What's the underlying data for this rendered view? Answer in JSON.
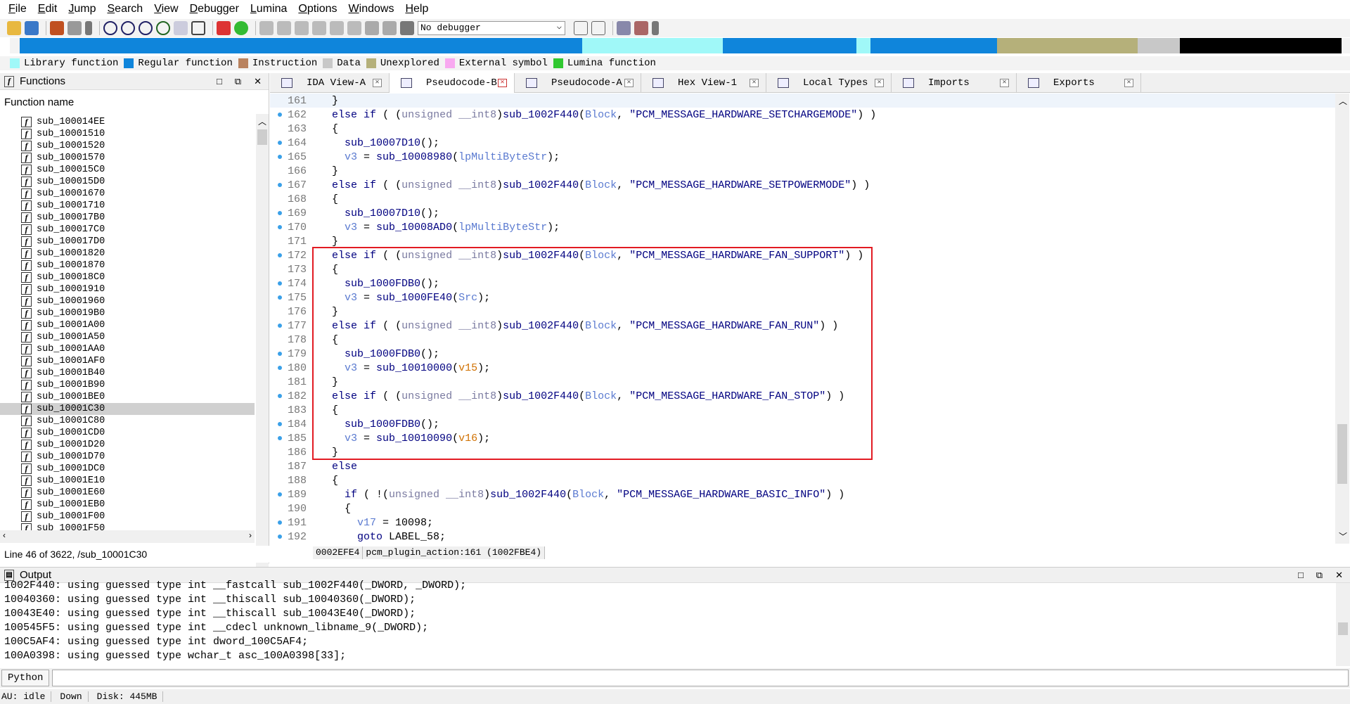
{
  "menu": [
    "File",
    "Edit",
    "Jump",
    "Search",
    "View",
    "Debugger",
    "Lumina",
    "Options",
    "Windows",
    "Help"
  ],
  "toolbar": {
    "debugger_select": "No debugger"
  },
  "legend": [
    {
      "label": "Library function",
      "color": "#a0f8f8"
    },
    {
      "label": "Regular function",
      "color": "#0f85db"
    },
    {
      "label": "Instruction",
      "color": "#b9825e"
    },
    {
      "label": "Data",
      "color": "#c8c8c8"
    },
    {
      "label": "Unexplored",
      "color": "#b5b07a"
    },
    {
      "label": "External symbol",
      "color": "#f8a8f0"
    },
    {
      "label": "Lumina function",
      "color": "#30c830"
    }
  ],
  "functions_panel": {
    "title": "Functions",
    "column_header": "Function name",
    "items": [
      "sub_100014EE",
      "sub_10001510",
      "sub_10001520",
      "sub_10001570",
      "sub_100015C0",
      "sub_100015D0",
      "sub_10001670",
      "sub_10001710",
      "sub_100017B0",
      "sub_100017C0",
      "sub_100017D0",
      "sub_10001820",
      "sub_10001870",
      "sub_100018C0",
      "sub_10001910",
      "sub_10001960",
      "sub_100019B0",
      "sub_10001A00",
      "sub_10001A50",
      "sub_10001AA0",
      "sub_10001AF0",
      "sub_10001B40",
      "sub_10001B90",
      "sub_10001BE0",
      "sub_10001C30",
      "sub_10001C80",
      "sub_10001CD0",
      "sub_10001D20",
      "sub_10001D70",
      "sub_10001DC0",
      "sub_10001E10",
      "sub_10001E60",
      "sub_10001EB0",
      "sub_10001F00",
      "sub_10001F50"
    ],
    "selected_index": 24,
    "status": "Line 46 of 3622, /sub_10001C30"
  },
  "tabs": [
    {
      "label": "IDA View-A",
      "active": false
    },
    {
      "label": "Pseudocode-B",
      "active": true
    },
    {
      "label": "Pseudocode-A",
      "active": false
    },
    {
      "label": "Hex View-1",
      "active": false
    },
    {
      "label": "Local Types",
      "active": false
    },
    {
      "label": "Imports",
      "active": false
    },
    {
      "label": "Exports",
      "active": false
    }
  ],
  "code_lines": [
    {
      "n": "161",
      "dot": false,
      "t": "  }"
    },
    {
      "n": "162",
      "dot": true,
      "t": "  else if ( (unsigned __int8)sub_1002F440(Block, \"PCM_MESSAGE_HARDWARE_SETCHARGEMODE\") )"
    },
    {
      "n": "163",
      "dot": false,
      "t": "  {"
    },
    {
      "n": "164",
      "dot": true,
      "t": "    sub_10007D10();"
    },
    {
      "n": "165",
      "dot": true,
      "t": "    v3 = sub_10008980(lpMultiByteStr);"
    },
    {
      "n": "166",
      "dot": false,
      "t": "  }"
    },
    {
      "n": "167",
      "dot": true,
      "t": "  else if ( (unsigned __int8)sub_1002F440(Block, \"PCM_MESSAGE_HARDWARE_SETPOWERMODE\") )"
    },
    {
      "n": "168",
      "dot": false,
      "t": "  {"
    },
    {
      "n": "169",
      "dot": true,
      "t": "    sub_10007D10();"
    },
    {
      "n": "170",
      "dot": true,
      "t": "    v3 = sub_10008AD0(lpMultiByteStr);"
    },
    {
      "n": "171",
      "dot": false,
      "t": "  }"
    },
    {
      "n": "172",
      "dot": true,
      "t": "  else if ( (unsigned __int8)sub_1002F440(Block, \"PCM_MESSAGE_HARDWARE_FAN_SUPPORT\") )"
    },
    {
      "n": "173",
      "dot": false,
      "t": "  {"
    },
    {
      "n": "174",
      "dot": true,
      "t": "    sub_1000FDB0();"
    },
    {
      "n": "175",
      "dot": true,
      "t": "    v3 = sub_1000FE40(Src);"
    },
    {
      "n": "176",
      "dot": false,
      "t": "  }"
    },
    {
      "n": "177",
      "dot": true,
      "t": "  else if ( (unsigned __int8)sub_1002F440(Block, \"PCM_MESSAGE_HARDWARE_FAN_RUN\") )"
    },
    {
      "n": "178",
      "dot": false,
      "t": "  {"
    },
    {
      "n": "179",
      "dot": true,
      "t": "    sub_1000FDB0();"
    },
    {
      "n": "180",
      "dot": true,
      "t": "    v3 = sub_10010000(v15);"
    },
    {
      "n": "181",
      "dot": false,
      "t": "  }"
    },
    {
      "n": "182",
      "dot": true,
      "t": "  else if ( (unsigned __int8)sub_1002F440(Block, \"PCM_MESSAGE_HARDWARE_FAN_STOP\") )"
    },
    {
      "n": "183",
      "dot": false,
      "t": "  {"
    },
    {
      "n": "184",
      "dot": true,
      "t": "    sub_1000FDB0();"
    },
    {
      "n": "185",
      "dot": true,
      "t": "    v3 = sub_10010090(v16);"
    },
    {
      "n": "186",
      "dot": false,
      "t": "  }"
    },
    {
      "n": "187",
      "dot": false,
      "t": "  else"
    },
    {
      "n": "188",
      "dot": false,
      "t": "  {"
    },
    {
      "n": "189",
      "dot": true,
      "t": "    if ( !(unsigned __int8)sub_1002F440(Block, \"PCM_MESSAGE_HARDWARE_BASIC_INFO\") )"
    },
    {
      "n": "190",
      "dot": false,
      "t": "    {"
    },
    {
      "n": "191",
      "dot": true,
      "t": "      v17 = 10098;"
    },
    {
      "n": "192",
      "dot": true,
      "t": "      goto LABEL_58;"
    }
  ],
  "code_status": {
    "offset": "0002EFE4",
    "location": "pcm_plugin_action:161 (1002FBE4)"
  },
  "output_panel": {
    "title": "Output",
    "lines": [
      "1002F440: using guessed type int __fastcall sub_1002F440(_DWORD, _DWORD);",
      "10040360: using guessed type int __thiscall sub_10040360(_DWORD);",
      "10043E40: using guessed type int __thiscall sub_10043E40(_DWORD);",
      "100545F5: using guessed type int __cdecl unknown_libname_9(_DWORD);",
      "100C5AF4: using guessed type int dword_100C5AF4;",
      "100A0398: using guessed type wchar_t asc_100A0398[33];"
    ]
  },
  "python_button": "Python",
  "statusbar": {
    "au": "AU:  idle",
    "down": "Down",
    "disk": "Disk: 445MB"
  }
}
